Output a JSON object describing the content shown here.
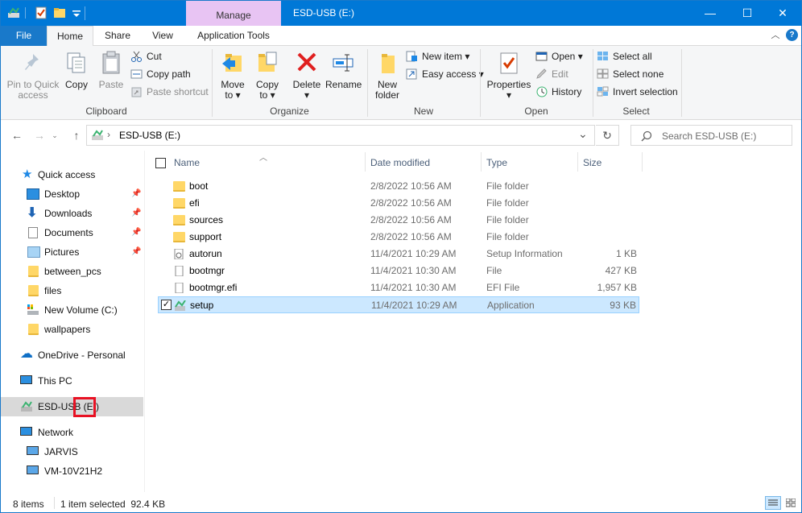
{
  "window": {
    "title": "ESD-USB (E:)",
    "contextual_tab": "Manage",
    "controls": {
      "minimize": "—",
      "maximize": "☐",
      "close": "✕"
    }
  },
  "tabs": [
    {
      "label": "File"
    },
    {
      "label": "Home"
    },
    {
      "label": "Share"
    },
    {
      "label": "View"
    },
    {
      "label": "Application Tools"
    }
  ],
  "ribbon": {
    "clipboard": {
      "group": "Clipboard",
      "pin_line1": "Pin to Quick",
      "pin_line2": "access",
      "copy": "Copy",
      "paste": "Paste",
      "cut": "Cut",
      "copy_path": "Copy path",
      "paste_shortcut": "Paste shortcut"
    },
    "organize": {
      "group": "Organize",
      "move_line1": "Move",
      "move_line2": "to ▾",
      "copy_line1": "Copy",
      "copy_line2": "to ▾",
      "delete_line1": "Delete",
      "delete_line2": "▾",
      "rename": "Rename"
    },
    "new": {
      "group": "New",
      "folder_line1": "New",
      "folder_line2": "folder",
      "new_item": "New item ▾",
      "easy_access": "Easy access ▾"
    },
    "open": {
      "group": "Open",
      "properties_line1": "Properties",
      "properties_line2": "▾",
      "open": "Open ▾",
      "edit": "Edit",
      "history": "History"
    },
    "select": {
      "group": "Select",
      "select_all": "Select all",
      "select_none": "Select none",
      "invert": "Invert selection"
    }
  },
  "address": {
    "back": "←",
    "forward": "→",
    "up": "↑",
    "separator": "›",
    "path": "ESD-USB (E:)",
    "dropdown": "⌄",
    "refresh": "↻",
    "search_placeholder": "Search ESD-USB (E:)"
  },
  "nav": {
    "quick_access": "Quick access",
    "desktop": "Desktop",
    "downloads": "Downloads",
    "documents": "Documents",
    "pictures": "Pictures",
    "between_pcs": "between_pcs",
    "files": "files",
    "new_volume": "New Volume (C:)",
    "wallpapers": "wallpapers",
    "onedrive": "OneDrive - Personal",
    "this_pc": "This PC",
    "esd_usb": "ESD-USB (E:)",
    "network": "Network",
    "jarvis": "JARVIS",
    "vm": "VM-10V21H2",
    "pin_glyph": "📌"
  },
  "columns": {
    "name": "Name",
    "date": "Date modified",
    "type": "Type",
    "size": "Size"
  },
  "files": [
    {
      "name": "boot",
      "date": "2/8/2022 10:56 AM",
      "type": "File folder",
      "size": "",
      "icon": "folder-icon"
    },
    {
      "name": "efi",
      "date": "2/8/2022 10:56 AM",
      "type": "File folder",
      "size": "",
      "icon": "folder-icon"
    },
    {
      "name": "sources",
      "date": "2/8/2022 10:56 AM",
      "type": "File folder",
      "size": "",
      "icon": "folder-icon"
    },
    {
      "name": "support",
      "date": "2/8/2022 10:56 AM",
      "type": "File folder",
      "size": "",
      "icon": "folder-icon"
    },
    {
      "name": "autorun",
      "date": "11/4/2021 10:29 AM",
      "type": "Setup Information",
      "size": "1 KB",
      "icon": "setup-info-icon"
    },
    {
      "name": "bootmgr",
      "date": "11/4/2021 10:30 AM",
      "type": "File",
      "size": "427 KB",
      "icon": "file-icon"
    },
    {
      "name": "bootmgr.efi",
      "date": "11/4/2021 10:30 AM",
      "type": "EFI File",
      "size": "1,957 KB",
      "icon": "file-icon"
    },
    {
      "name": "setup",
      "date": "11/4/2021 10:29 AM",
      "type": "Application",
      "size": "93 KB",
      "icon": "setup-app-icon"
    }
  ],
  "status": {
    "items": "8 items",
    "selected": "1 item selected  92.4 KB"
  },
  "colors": {
    "titlebar": "#0078d7",
    "manage_tab": "#e8c4f3",
    "selection": "#cce8ff",
    "highlight_box": "#e81123"
  }
}
